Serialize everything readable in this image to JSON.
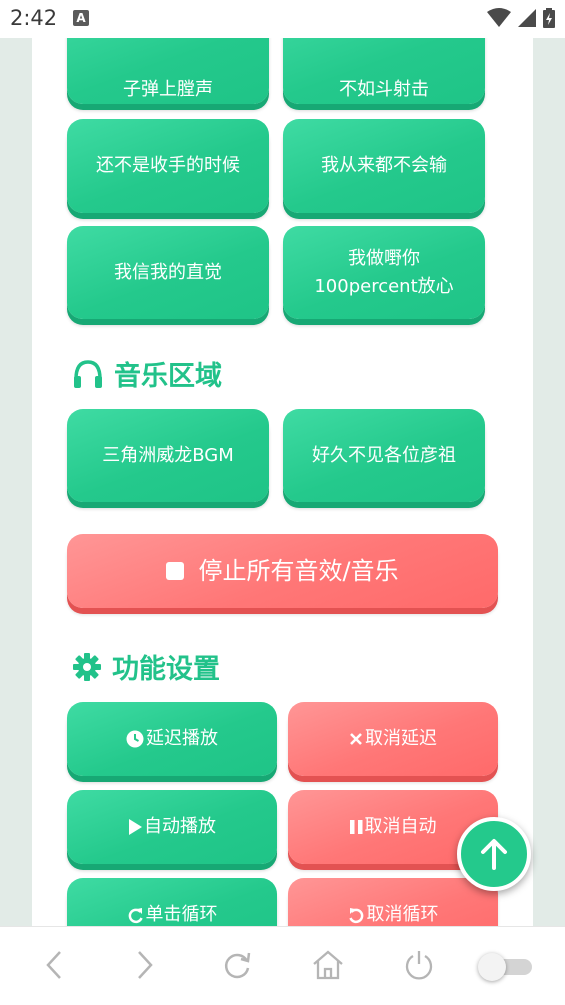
{
  "status": {
    "time": "2:42",
    "notif": "A"
  },
  "sound_buttons": [
    "子弹上膛声",
    "不如斗射击",
    "还不是收手的时候",
    "我从来都不会输",
    "我信我的直觉",
    "我做嘢你\n100percent放心"
  ],
  "music": {
    "title": "音乐区域",
    "buttons": [
      "三角洲威龙BGM",
      "好久不见各位彦祖"
    ]
  },
  "stop_button": "停止所有音效/音乐",
  "settings": {
    "title": "功能设置",
    "buttons": [
      "延迟播放",
      "取消延迟",
      "自动播放",
      "取消自动",
      "单击循环",
      "取消循环"
    ]
  },
  "colors": {
    "green": "#24c98c",
    "red": "#ff7777",
    "title_green": "#22c28a"
  }
}
